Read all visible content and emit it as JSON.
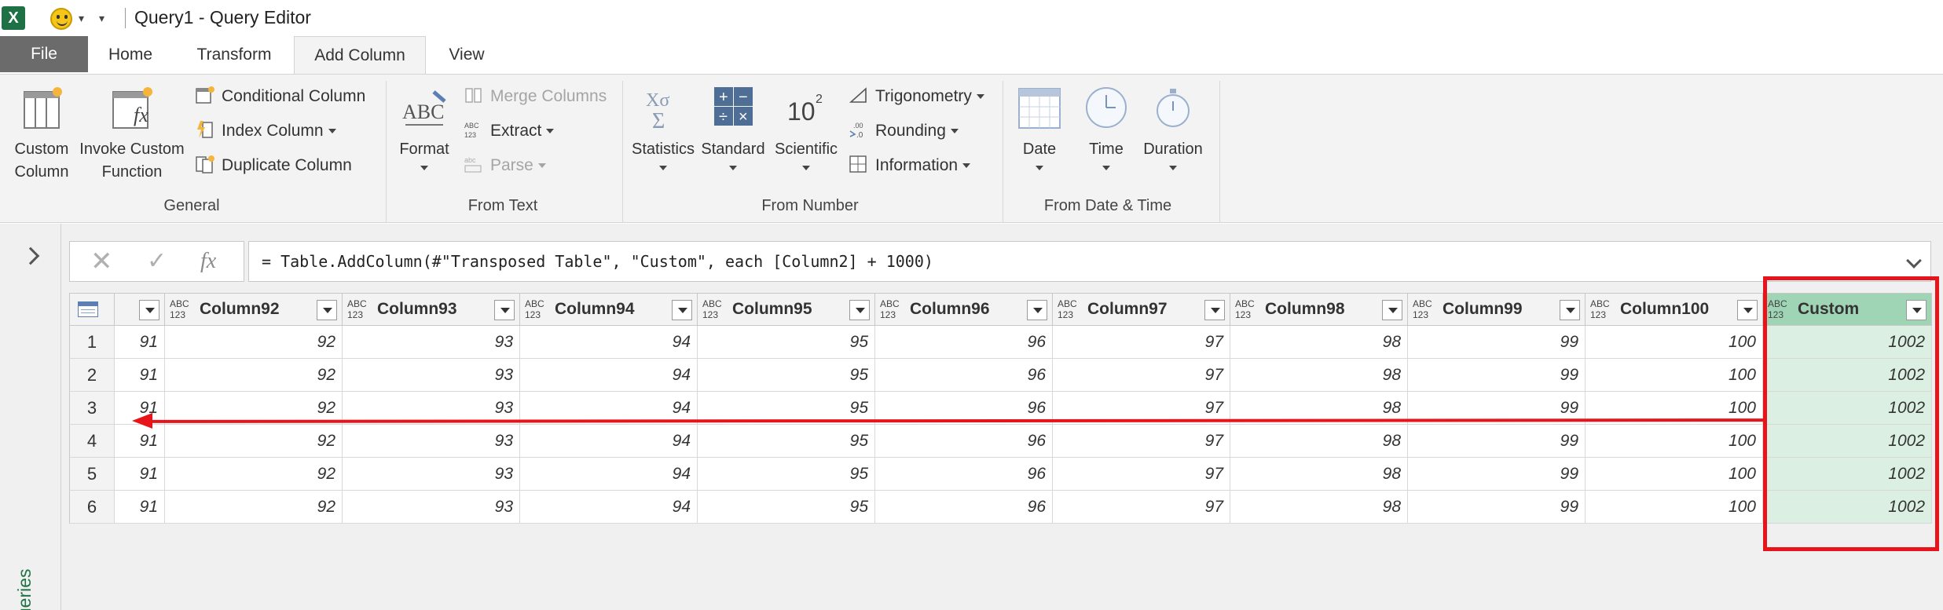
{
  "window": {
    "title": "Query1 - Query Editor",
    "app_icon_letter": "X"
  },
  "tabs": [
    {
      "label": "File"
    },
    {
      "label": "Home"
    },
    {
      "label": "Transform"
    },
    {
      "label": "Add Column"
    },
    {
      "label": "View"
    }
  ],
  "ribbon": {
    "general": {
      "label": "General",
      "custom_column": [
        "Custom",
        "Column"
      ],
      "invoke_custom_function": [
        "Invoke Custom",
        "Function"
      ],
      "conditional_column": "Conditional Column",
      "index_column": "Index Column",
      "duplicate_column": "Duplicate Column"
    },
    "from_text": {
      "label": "From Text",
      "format": "Format",
      "merge_columns": "Merge Columns",
      "extract": "Extract",
      "parse": "Parse"
    },
    "from_number": {
      "label": "From Number",
      "statistics": "Statistics",
      "standard": "Standard",
      "scientific": "Scientific",
      "trigonometry": "Trigonometry",
      "rounding": "Rounding",
      "information": "Information"
    },
    "from_date_time": {
      "label": "From Date & Time",
      "date": "Date",
      "time": "Time",
      "duration": "Duration"
    }
  },
  "side_pane": {
    "label": "Queries"
  },
  "formula_bar": {
    "fx": "fx",
    "formula": "= Table.AddColumn(#\"Transposed Table\", \"Custom\", each [Column2] + 1000)"
  },
  "grid": {
    "type_label": [
      "ABC",
      "123"
    ],
    "columns": [
      "Column92",
      "Column93",
      "Column94",
      "Column95",
      "Column96",
      "Column97",
      "Column98",
      "Column99",
      "Column100",
      "Custom"
    ],
    "rows": [
      {
        "n": "1",
        "values": [
          "91",
          "92",
          "93",
          "94",
          "95",
          "96",
          "97",
          "98",
          "99",
          "100",
          "1002"
        ]
      },
      {
        "n": "2",
        "values": [
          "91",
          "92",
          "93",
          "94",
          "95",
          "96",
          "97",
          "98",
          "99",
          "100",
          "1002"
        ]
      },
      {
        "n": "3",
        "values": [
          "91",
          "92",
          "93",
          "94",
          "95",
          "96",
          "97",
          "98",
          "99",
          "100",
          "1002"
        ]
      },
      {
        "n": "4",
        "values": [
          "91",
          "92",
          "93",
          "94",
          "95",
          "96",
          "97",
          "98",
          "99",
          "100",
          "1002"
        ]
      },
      {
        "n": "5",
        "values": [
          "91",
          "92",
          "93",
          "94",
          "95",
          "96",
          "97",
          "98",
          "99",
          "100",
          "1002"
        ]
      },
      {
        "n": "6",
        "values": [
          "91",
          "92",
          "93",
          "94",
          "95",
          "96",
          "97",
          "98",
          "99",
          "100",
          "1002"
        ]
      }
    ]
  },
  "colors": {
    "excel_green": "#217346",
    "highlight_red": "#e8141c",
    "custom_header": "#9fd5b5",
    "custom_cell": "#dbf0e2"
  }
}
